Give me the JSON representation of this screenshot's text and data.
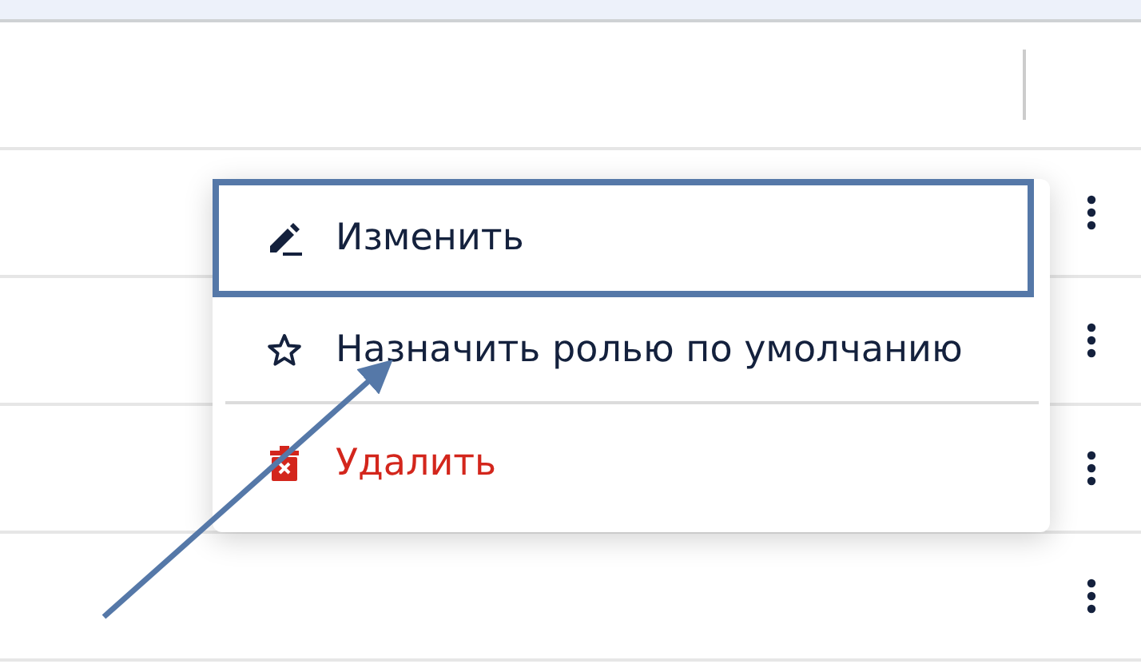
{
  "context_menu": {
    "items": [
      {
        "label": "Изменить",
        "kind": "edit",
        "highlighted": true,
        "divider_before": false
      },
      {
        "label": "Назначить ролью по умолчанию",
        "kind": "star",
        "highlighted": false,
        "divider_before": false
      },
      {
        "label": "Удалить",
        "kind": "delete",
        "highlighted": false,
        "divider_before": true
      }
    ]
  }
}
